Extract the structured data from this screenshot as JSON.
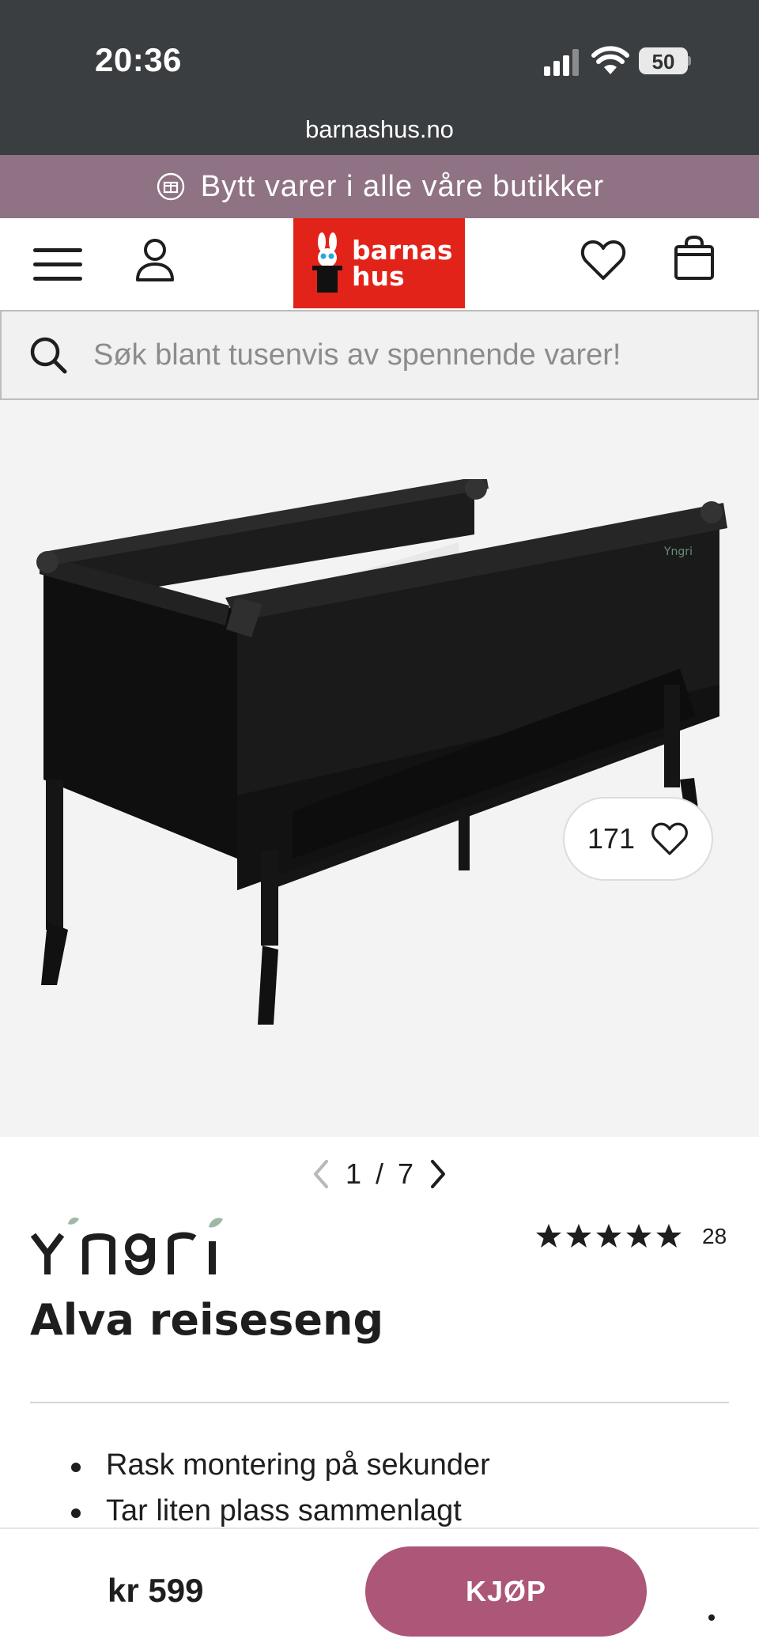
{
  "status_bar": {
    "time": "20:36",
    "battery": "50",
    "url": "barnashus.no"
  },
  "promo": {
    "text": "Bytt varer i alle våre butikker",
    "icon": "exchange-icon"
  },
  "header": {
    "logo_line1": "barnas",
    "logo_line2": "hus",
    "icons": [
      "menu-icon",
      "user-icon",
      "heart-icon",
      "bag-icon"
    ],
    "brand_color": "#e2231a"
  },
  "search": {
    "placeholder": "Søk blant tusenvis av spennende varer!"
  },
  "gallery": {
    "favorites_count": "171",
    "current": "1",
    "separator": "/",
    "total": "7"
  },
  "product": {
    "brand": "Yngri",
    "rating_stars": 5,
    "review_count": "28",
    "title": "Alva reiseseng",
    "features": [
      "Rask montering på sekunder",
      "Tar liten plass sammenlagt"
    ]
  },
  "buybar": {
    "price": "kr 599",
    "buy_label": "KJØP",
    "accent": "#ac5678"
  },
  "colors": {
    "status_bg": "#3b3e40",
    "promo_bg": "#8f7284",
    "gallery_bg": "#f3f3f3"
  }
}
